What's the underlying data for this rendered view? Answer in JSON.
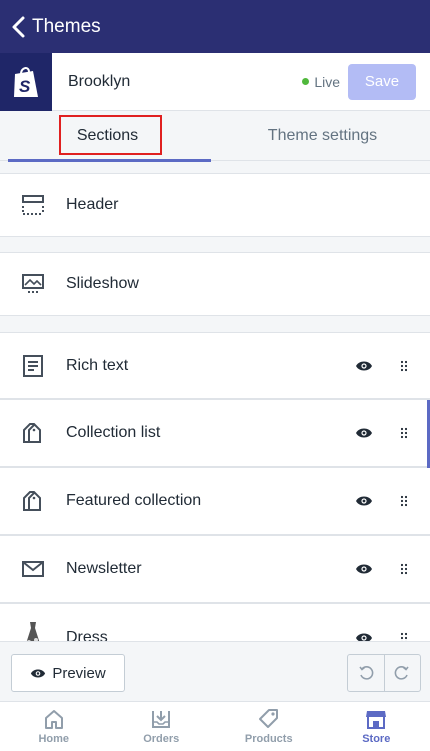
{
  "topbar": {
    "back_label": "Themes"
  },
  "store": {
    "name": "Brooklyn",
    "status": "Live",
    "save_label": "Save",
    "logo_letter": "S"
  },
  "tabs": [
    {
      "label": "Sections",
      "active": true
    },
    {
      "label": "Theme settings",
      "active": false
    }
  ],
  "sections": [
    {
      "label": "Header",
      "icon": "header-layout-icon"
    },
    {
      "label": "Slideshow",
      "icon": "slideshow-icon"
    },
    {
      "label": "Rich text",
      "icon": "rich-text-icon"
    },
    {
      "label": "Collection list",
      "icon": "collection-icon"
    },
    {
      "label": "Featured collection",
      "icon": "collection-icon"
    },
    {
      "label": "Newsletter",
      "icon": "envelope-icon"
    },
    {
      "label": "Dress",
      "icon": "dress-thumbnail"
    }
  ],
  "footer": {
    "preview_label": "Preview"
  },
  "nav": [
    {
      "label": "Home",
      "icon": "home-icon",
      "active": false
    },
    {
      "label": "Orders",
      "icon": "orders-icon",
      "active": false
    },
    {
      "label": "Products",
      "icon": "tag-icon",
      "active": false
    },
    {
      "label": "Store",
      "icon": "store-icon",
      "active": true
    }
  ],
  "colors": {
    "topbar": "#2b2f73",
    "accent": "#5c6ac4",
    "live_dot": "#50b83c",
    "save_disabled": "#b3bcf5"
  }
}
